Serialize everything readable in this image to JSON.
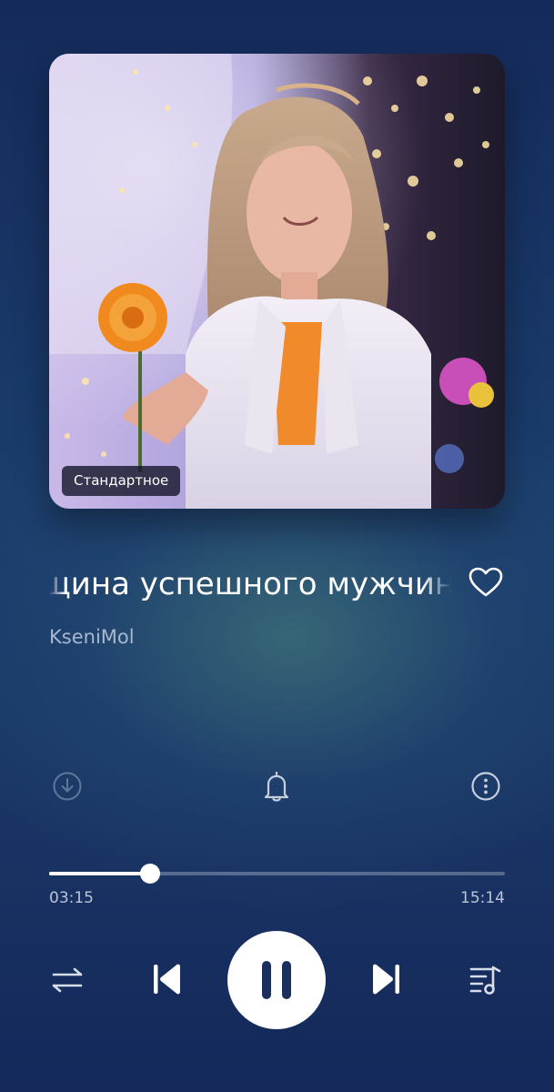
{
  "track": {
    "title": "Женщина успешного мужчины",
    "artist": "KseniMol",
    "quality_badge": "Стандартное",
    "liked": false
  },
  "cover": {
    "description_icon": "album-cover-image"
  },
  "actions": {
    "download_icon": "download-circle-icon",
    "alarm_icon": "bell-icon",
    "more_icon": "more-vertical-circle-icon"
  },
  "playback": {
    "elapsed": "03:15",
    "duration": "15:14",
    "progress_fraction": 0.2222,
    "state": "playing"
  },
  "controls": {
    "repeat_icon": "repeat-order-icon",
    "prev_icon": "previous-track-icon",
    "pause_icon": "pause-icon",
    "next_icon": "next-track-icon",
    "queue_icon": "playlist-queue-icon"
  },
  "colors": {
    "background_top": "#142a5a",
    "background_glow": "#3c6e78",
    "accent": "#ffffff",
    "secondary_text": "#a8b8cf"
  }
}
